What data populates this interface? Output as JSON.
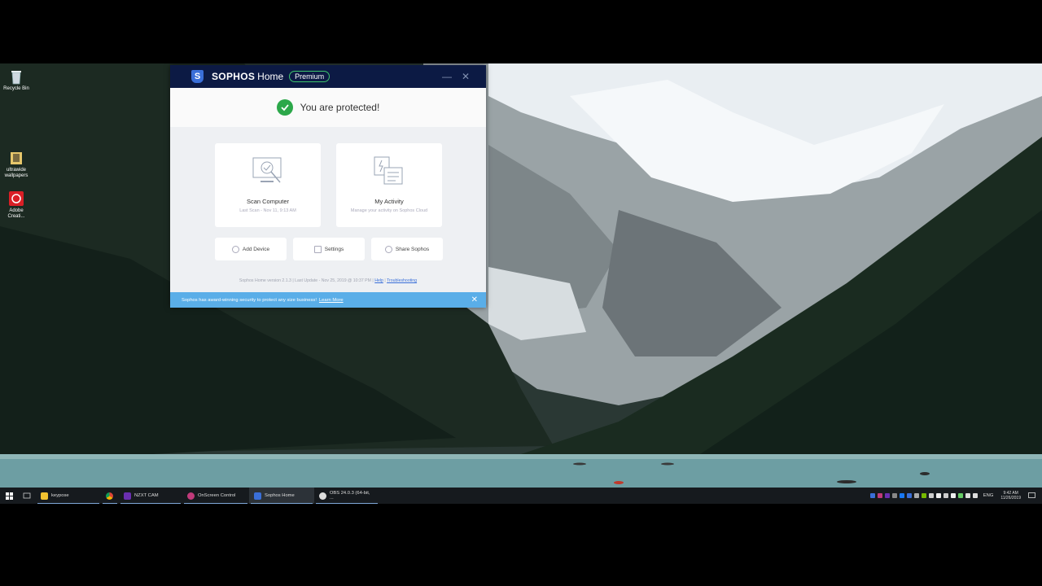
{
  "desktop": {
    "icons": [
      {
        "label": "Recycle Bin",
        "icon": "recycle-bin-icon"
      },
      {
        "label": "ultrawide wallpapers",
        "icon": "folder-icon"
      },
      {
        "label": "Adobe Creati...",
        "icon": "adobe-creative-cloud-icon"
      }
    ]
  },
  "sophos": {
    "brand": "SOPHOS",
    "brand_sub": "Home",
    "badge": "Premium",
    "status": "You are protected!",
    "cards": [
      {
        "title": "Scan Computer",
        "subtitle": "Last Scan - Nov 11, 9:13 AM",
        "icon": "scan-computer-icon"
      },
      {
        "title": "My Activity",
        "subtitle": "Manage your activity on Sophos Cloud",
        "icon": "my-activity-icon"
      }
    ],
    "actions": [
      {
        "label": "Add Device",
        "icon": "add-icon"
      },
      {
        "label": "Settings",
        "icon": "settings-icon"
      },
      {
        "label": "Share Sophos",
        "icon": "share-icon"
      }
    ],
    "footer": {
      "version": "Sophos Home version 2.1.3 | Last Update - Nov 25, 2019 @ 10:37 PM |",
      "help": "Help",
      "separator": "|",
      "troubleshooting": "Troubleshooting"
    },
    "promo": {
      "text": "Sophos has award-winning security to protect any size business!",
      "link": "Learn More",
      "close": "✕"
    },
    "colors": {
      "titlebar": "#0c1a44",
      "accent": "#3a6fd8",
      "success": "#2ca84a",
      "promo": "#5aaee8"
    }
  },
  "taskbar": {
    "apps": [
      {
        "label": "keypose",
        "icon": "file-explorer-icon",
        "color": "#f2c230",
        "active": false
      },
      {
        "label": "",
        "icon": "chrome-icon",
        "color": "#e8e8e8",
        "active": false
      },
      {
        "label": "NZXT CAM",
        "icon": "nzxt-cam-icon",
        "color": "#6a2fb0",
        "active": false
      },
      {
        "label": "OnScreen Control",
        "icon": "onscreen-control-icon",
        "color": "#c03a7a",
        "active": false
      },
      {
        "label": "Sophos Home",
        "icon": "sophos-icon",
        "color": "#3a6fd8",
        "active": true
      },
      {
        "label": "OBS 24.0.3 (64-bit, ...",
        "icon": "obs-icon",
        "color": "#ddd",
        "active": false
      }
    ],
    "language": "ENG",
    "time": "9:42 AM",
    "date": "11/26/2019"
  }
}
